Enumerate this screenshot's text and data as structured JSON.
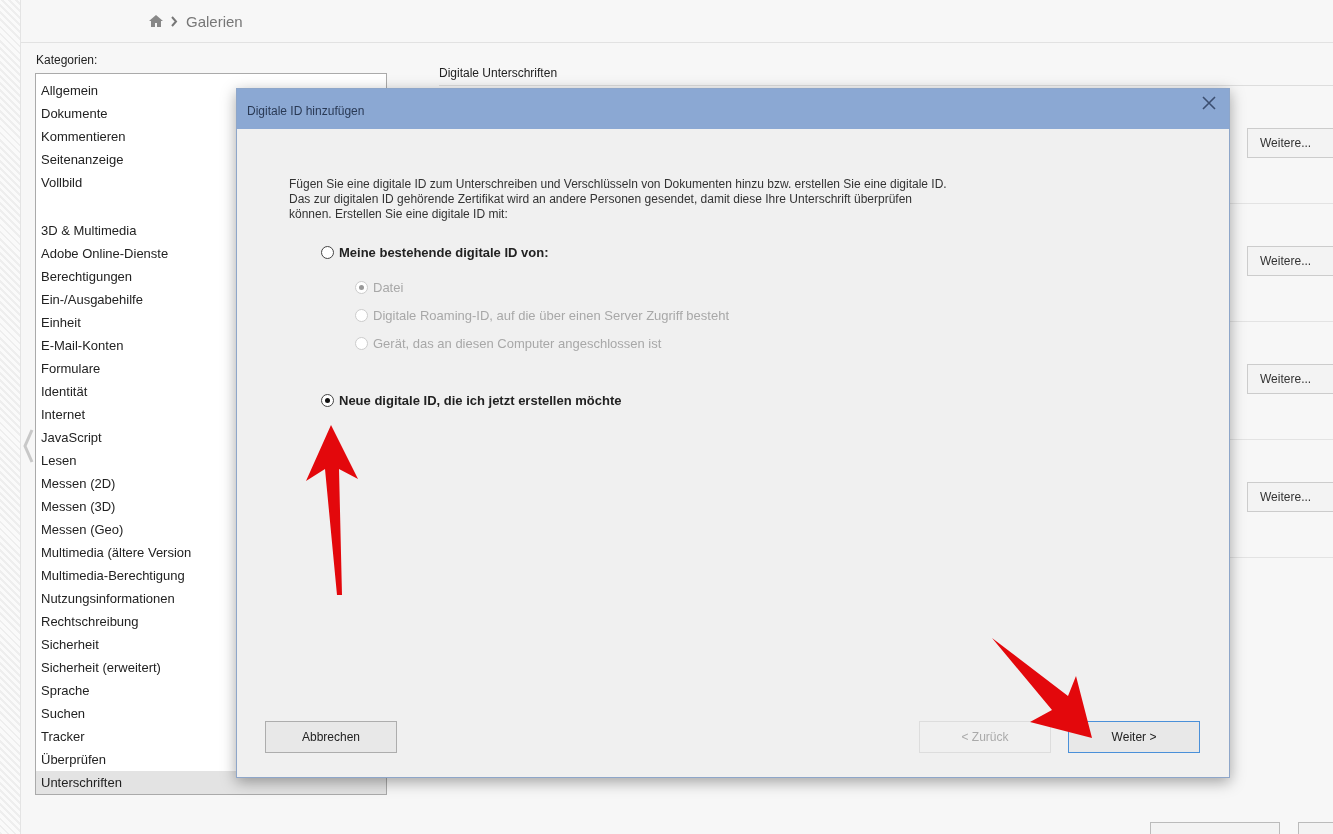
{
  "breadcrumb": {
    "items": [
      "Galerien"
    ]
  },
  "categories": {
    "label": "Kategorien:",
    "groups": [
      [
        {
          "label": "Allgemein",
          "selected": false
        },
        {
          "label": "Dokumente",
          "selected": false
        },
        {
          "label": "Kommentieren",
          "selected": false
        },
        {
          "label": "Seitenanzeige",
          "selected": false
        },
        {
          "label": "Vollbild",
          "selected": false
        }
      ],
      [
        {
          "label": "3D & Multimedia",
          "selected": false
        },
        {
          "label": "Adobe Online-Dienste",
          "selected": false
        },
        {
          "label": "Berechtigungen",
          "selected": false
        },
        {
          "label": "Ein-/Ausgabehilfe",
          "selected": false
        },
        {
          "label": "Einheit",
          "selected": false
        },
        {
          "label": "E-Mail-Konten",
          "selected": false
        },
        {
          "label": "Formulare",
          "selected": false
        },
        {
          "label": "Identität",
          "selected": false
        },
        {
          "label": "Internet",
          "selected": false
        },
        {
          "label": "JavaScript",
          "selected": false
        },
        {
          "label": "Lesen",
          "selected": false
        },
        {
          "label": "Messen (2D)",
          "selected": false
        },
        {
          "label": "Messen (3D)",
          "selected": false
        },
        {
          "label": "Messen (Geo)",
          "selected": false
        },
        {
          "label": "Multimedia (ältere Version",
          "selected": false
        },
        {
          "label": "Multimedia-Berechtigung",
          "selected": false
        },
        {
          "label": "Nutzungsinformationen",
          "selected": false
        },
        {
          "label": "Rechtschreibung",
          "selected": false
        },
        {
          "label": "Sicherheit",
          "selected": false
        },
        {
          "label": "Sicherheit (erweitert)",
          "selected": false
        },
        {
          "label": "Sprache",
          "selected": false
        },
        {
          "label": "Suchen",
          "selected": false
        },
        {
          "label": "Tracker",
          "selected": false
        },
        {
          "label": "Überprüfen",
          "selected": false
        },
        {
          "label": "Unterschriften",
          "selected": true
        }
      ]
    ]
  },
  "panel": {
    "title": "Digitale Unterschriften",
    "sections": [
      {
        "button": "Weitere..."
      },
      {
        "button": "Weitere..."
      },
      {
        "button": "Weitere..."
      },
      {
        "button": "Weitere..."
      }
    ]
  },
  "dialog": {
    "title": "Digitale ID hinzufügen",
    "description": "Fügen Sie eine digitale ID zum Unterschreiben und Verschlüsseln von Dokumenten hinzu bzw. erstellen Sie eine digitale ID. Das zur digitalen ID gehörende Zertifikat wird an andere Personen gesendet, damit diese Ihre Unterschrift überprüfen können. Erstellen Sie eine digitale ID mit:",
    "options": [
      {
        "label": "Meine bestehende digitale ID von:",
        "selected": false,
        "children": [
          {
            "label": "Datei",
            "selected": true,
            "disabled": true
          },
          {
            "label": "Digitale Roaming-ID, auf die über einen Server Zugriff besteht",
            "selected": false,
            "disabled": true
          },
          {
            "label": "Gerät, das an diesen Computer angeschlossen ist",
            "selected": false,
            "disabled": true
          }
        ]
      },
      {
        "label": "Neue digitale ID, die ich jetzt erstellen möchte",
        "selected": true
      }
    ],
    "buttons": [
      {
        "label": "Abbrechen",
        "disabled": false,
        "focused": false
      },
      {
        "label": "< Zurück",
        "disabled": true,
        "focused": false
      },
      {
        "label": "Weiter >",
        "disabled": false,
        "focused": true
      }
    ]
  }
}
